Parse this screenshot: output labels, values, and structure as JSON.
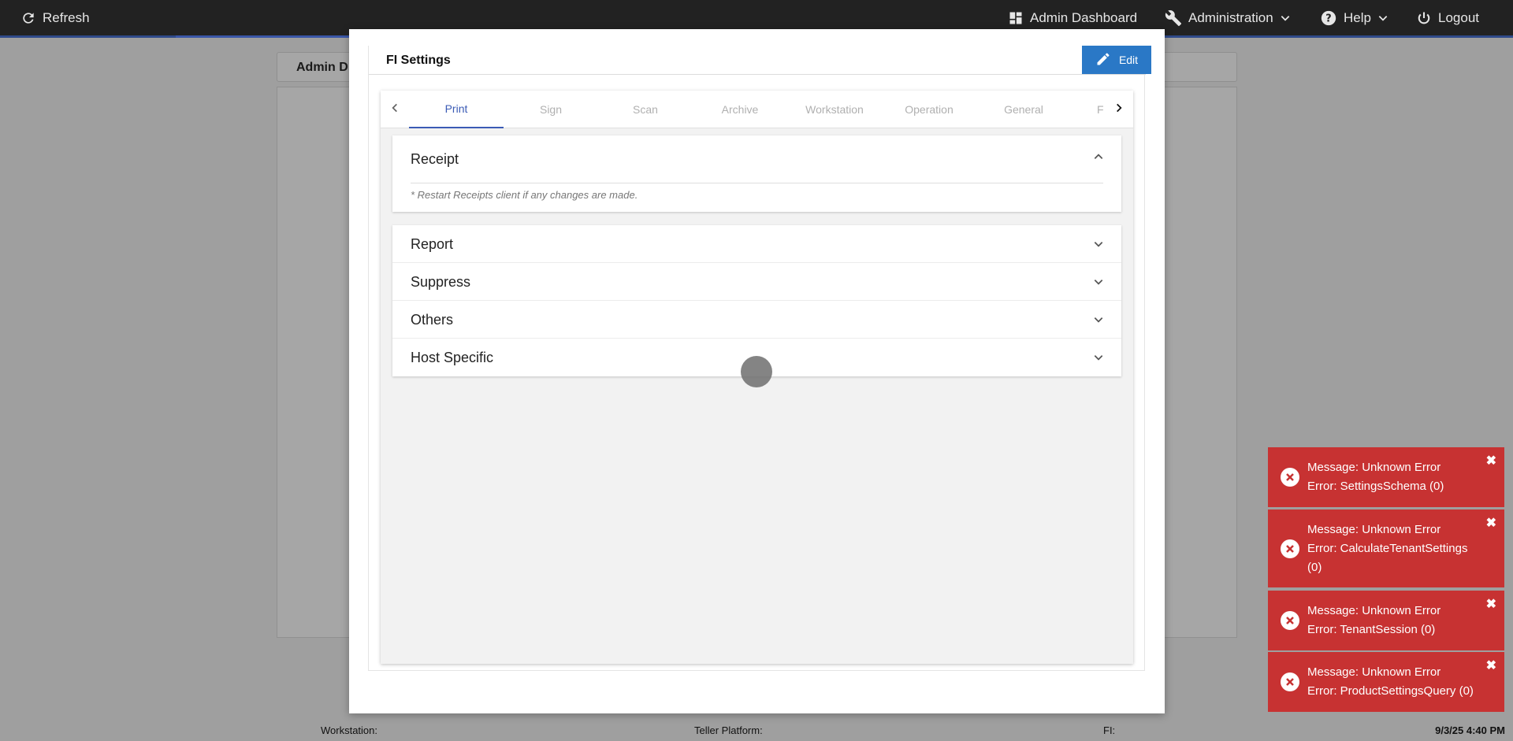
{
  "topbar": {
    "refresh_label": "Refresh",
    "admin_dashboard_label": "Admin Dashboard",
    "administration_label": "Administration",
    "help_label": "Help",
    "logout_label": "Logout"
  },
  "background": {
    "tab_title": "Admin D"
  },
  "modal": {
    "title": "FI Settings",
    "edit_label": "Edit",
    "tabs": [
      "Print",
      "Sign",
      "Scan",
      "Archive",
      "Workstation",
      "Operation",
      "General",
      "F"
    ],
    "active_tab": "Print",
    "receipt": {
      "title": "Receipt",
      "note": "* Restart Receipts client if any changes are made."
    },
    "sections": [
      "Report",
      "Suppress",
      "Others",
      "Host Specific"
    ]
  },
  "statusbar": {
    "workstation_label": "Workstation:",
    "teller_platform_label": "Teller Platform:",
    "fi_label": "FI:",
    "datetime": "9/3/25 4:40 PM"
  },
  "toasts": [
    {
      "line1": "Message: Unknown Error",
      "line2": "Error: SettingsSchema (0)"
    },
    {
      "line1": "Message: Unknown Error",
      "line2": "Error: CalculateTenantSettings (0)"
    },
    {
      "line1": "Message: Unknown Error",
      "line2": "Error: TenantSession (0)"
    },
    {
      "line1": "Message: Unknown Error",
      "line2": "Error: ProductSettingsQuery (0)"
    }
  ],
  "colors": {
    "topbar": "#222222",
    "accent": "#3b5bb5",
    "edit_button": "#2a78c6",
    "error_toast": "#c73232"
  },
  "icons": [
    "refresh-icon",
    "dashboard-icon",
    "wrench-icon",
    "help-icon",
    "power-icon",
    "pencil-icon",
    "chevron-left-icon",
    "chevron-right-icon",
    "chevron-up-icon",
    "chevron-down-icon",
    "error-icon",
    "close-icon"
  ]
}
